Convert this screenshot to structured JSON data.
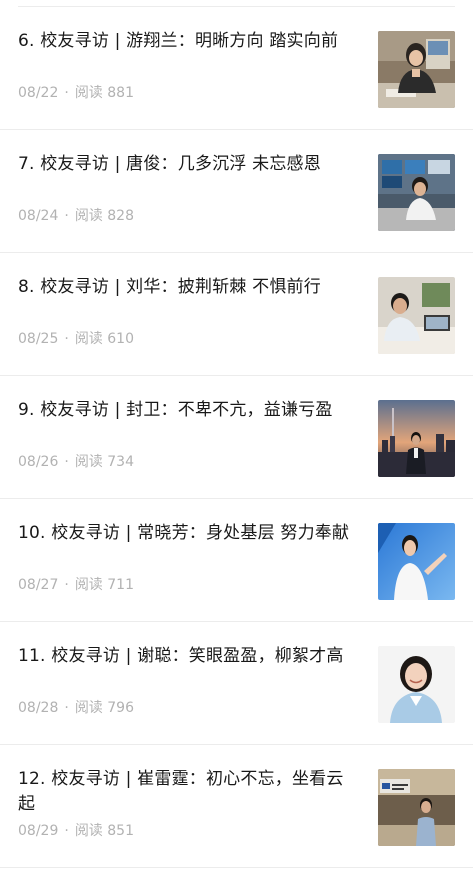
{
  "articles": [
    {
      "title": "6. 校友寻访 | 游翔兰：明晰方向 踏实向前",
      "date": "08/22",
      "read_label": "阅读",
      "read_count": "881",
      "thumb": "woman-at-desk-photo"
    },
    {
      "title": "7. 校友寻访 | 唐俊：几多沉浮 未忘感恩",
      "date": "08/24",
      "read_label": "阅读",
      "read_count": "828",
      "thumb": "man-in-control-room-photo"
    },
    {
      "title": "8. 校友寻访 | 刘华：披荆斩棘 不惧前行",
      "date": "08/25",
      "read_label": "阅读",
      "read_count": "610",
      "thumb": "man-with-laptop-photo"
    },
    {
      "title": "9. 校友寻访 | 封卫：不卑不亢，益谦亏盈",
      "date": "08/26",
      "read_label": "阅读",
      "read_count": "734",
      "thumb": "man-before-city-skyline-photo"
    },
    {
      "title": "10. 校友寻访 | 常晓芳：身处基层 努力奉献",
      "date": "08/27",
      "read_label": "阅读",
      "read_count": "711",
      "thumb": "woman-presenting-photo"
    },
    {
      "title": "11. 校友寻访 | 谢聪：笑眼盈盈，柳絮才高",
      "date": "08/28",
      "read_label": "阅读",
      "read_count": "796",
      "thumb": "smiling-woman-portrait-photo"
    },
    {
      "title": "12. 校友寻访 | 崔雷霆：初心不忘，坐看云起",
      "date": "08/29",
      "read_label": "阅读",
      "read_count": "851",
      "thumb": "man-in-office-lobby-photo"
    }
  ],
  "colors": {
    "title": "#191919",
    "meta": "#b2b2b2",
    "divider": "#ececec"
  }
}
